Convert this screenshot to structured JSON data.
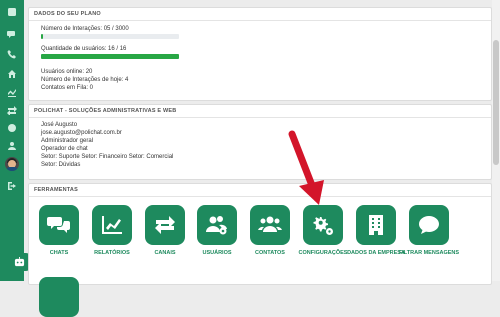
{
  "plan": {
    "title": "DADOS DO SEU PLANO",
    "interactions_text": "Número de Interações: 05 / 3000",
    "interactions_progress": 0.017,
    "users_text": "Quantidade de usuários: 16 / 16",
    "users_progress": 1.0,
    "online_text": "Usuários online: 20",
    "today_text": "Número de Interações de hoje: 4",
    "queue_text": "Contatos em Fila: 0"
  },
  "company": {
    "title": "POLICHAT - SOLUÇÕES ADMINISTRATIVAS E WEB",
    "name": "José Augusto",
    "email": "jose.augusto@polichat.com.br",
    "role1": "Administrador geral",
    "role2": "Operador de chat",
    "sectors": "Setor: Suporte Setor: Financeiro Setor: Comercial",
    "sector_extra": "Setor: Dúvidas"
  },
  "tools": {
    "title": "FERRAMENTAS",
    "items": [
      {
        "label": "CHATS",
        "icon": "chat-bubbles-icon"
      },
      {
        "label": "RELATÓRIOS",
        "icon": "chart-line-icon"
      },
      {
        "label": "CANAIS",
        "icon": "exchange-arrows-icon"
      },
      {
        "label": "USUÁRIOS",
        "icon": "users-cog-icon"
      },
      {
        "label": "CONTATOS",
        "icon": "users-icon"
      },
      {
        "label": "CONFIGURAÇÕES",
        "icon": "cogs-icon"
      },
      {
        "label": "DADOS DA EMPRESA",
        "icon": "building-icon"
      },
      {
        "label": "FILTRAR MENSAGENS",
        "icon": "comment-icon"
      }
    ]
  },
  "colors": {
    "brand": "#1e8a5e",
    "progress": "#28a745",
    "annotation_arrow": "#d3152a"
  }
}
